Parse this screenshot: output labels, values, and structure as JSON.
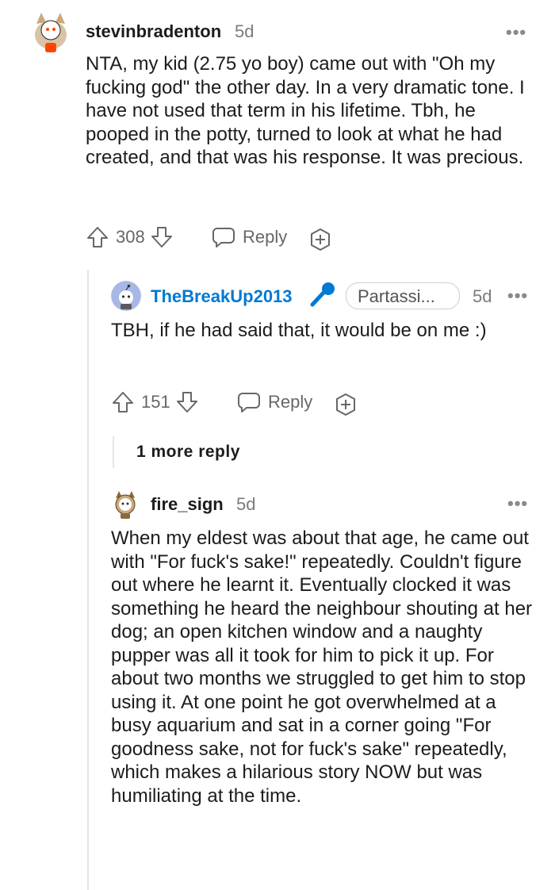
{
  "comments": [
    {
      "username": "stevinbradenton",
      "age": "5d",
      "text": "NTA, my kid (2.75 yo boy) came out with \"Oh my fucking god\" the other day. In a very dramatic tone. I have not used that term in his lifetime. Tbh, he pooped in the potty, turned to look at what he had created, and that was his response. It was precious.",
      "votes": "308",
      "reply_label": "Reply"
    },
    {
      "username": "TheBreakUp2013",
      "flair": "Partassi...",
      "age": "5d",
      "text": "TBH, if he had said that, it would be on me :)",
      "votes": "151",
      "reply_label": "Reply"
    },
    {
      "more_replies": "1 more reply"
    },
    {
      "username": "fire_sign",
      "age": "5d",
      "text": "When my eldest was about that age, he came out with \"For fuck's sake!\" repeatedly. Couldn't figure out where he learnt it. Eventually clocked it was something he heard the neighbour shouting at her dog; an open kitchen window and a naughty pupper was all it took for him to pick it up. For about two months we struggled to get him to stop using it. At one point he got overwhelmed at a busy aquarium and sat in a corner going \"For goodness sake, not for fuck's sake\" repeatedly, which makes a hilarious story NOW but was humiliating at the time."
    }
  ],
  "icons": {
    "more": "more-options-icon",
    "upvote": "upvote-arrow-icon",
    "downvote": "downvote-arrow-icon",
    "reply": "reply-bubble-icon",
    "award": "award-plus-icon",
    "mic": "microphone-icon"
  }
}
